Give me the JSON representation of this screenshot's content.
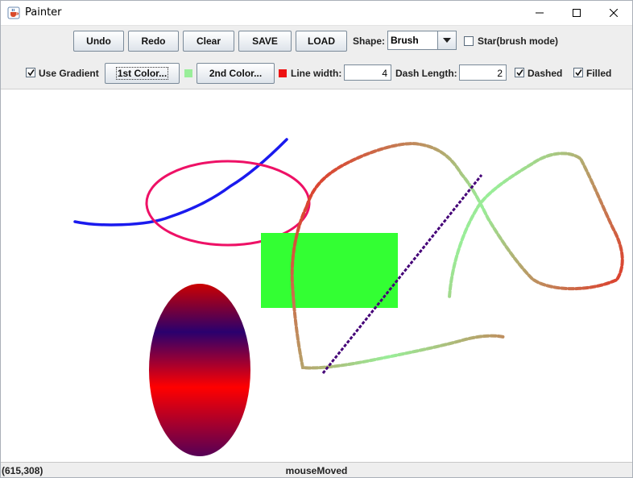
{
  "window": {
    "title": "Painter",
    "icon": "java-cup-icon",
    "controls": [
      "minimize-icon",
      "maximize-icon",
      "close-icon"
    ]
  },
  "toolbar1": {
    "undo_label": "Undo",
    "redo_label": "Redo",
    "clear_label": "Clear",
    "save_label": "SAVE",
    "load_label": "LOAD",
    "shape_label": "Shape:",
    "shape_value": "Brush",
    "star_label": "Star(brush mode)",
    "star_checked": false
  },
  "toolbar2": {
    "use_gradient_label": "Use Gradient",
    "use_gradient_checked": true,
    "first_color_label": "1st Color...",
    "first_color": "#99ee99",
    "second_color_label": "2nd Color...",
    "second_color": "#ee1111",
    "line_width_label": "Line width:",
    "line_width_value": "4",
    "dash_length_label": "Dash Length:",
    "dash_length_value": "2",
    "dashed_label": "Dashed",
    "dashed_checked": true,
    "filled_label": "Filled",
    "filled_checked": true
  },
  "canvas": {
    "shapes": [
      {
        "kind": "brush-stroke",
        "color": "#1a1aee"
      },
      {
        "kind": "oval-outline",
        "color": "#ee1166"
      },
      {
        "kind": "filled-rectangle",
        "color": "#33ff33"
      },
      {
        "kind": "gradient-oval",
        "colors": [
          "#cc0000",
          "#2a006e",
          "#ff0000",
          "#550055"
        ]
      },
      {
        "kind": "dashed-line",
        "color": "#440077"
      },
      {
        "kind": "gradient-dashed-brush",
        "colors": [
          "#99ee99",
          "#ee1111"
        ]
      }
    ]
  },
  "status": {
    "coords": "(615,308)",
    "event": "mouseMoved"
  }
}
